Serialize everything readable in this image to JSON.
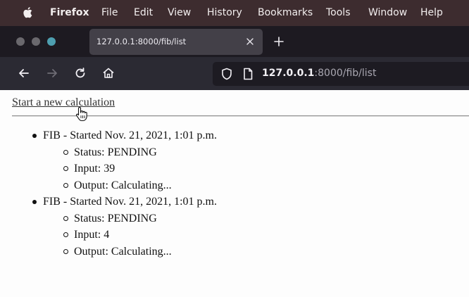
{
  "menubar": {
    "app_name": "Firefox",
    "items": [
      "File",
      "Edit",
      "View",
      "History",
      "Bookmarks",
      "Tools",
      "Window",
      "Help"
    ]
  },
  "window_controls": {
    "colors": [
      "#6a686d",
      "#6a686d",
      "#4e9fb0"
    ]
  },
  "tab": {
    "title": "127.0.0.1:8000/fib/list"
  },
  "address_bar": {
    "host": "127.0.0.1",
    "path": ":8000/fib/list"
  },
  "page": {
    "new_calc_link": "Start a new calculation",
    "tasks": [
      {
        "title": "FIB - Started Nov. 21, 2021, 1:01 p.m.",
        "status": "Status: PENDING",
        "input": "Input: 39",
        "output": "Output: Calculating..."
      },
      {
        "title": "FIB - Started Nov. 21, 2021, 1:01 p.m.",
        "status": "Status: PENDING",
        "input": "Input: 4",
        "output": "Output: Calculating..."
      }
    ]
  }
}
